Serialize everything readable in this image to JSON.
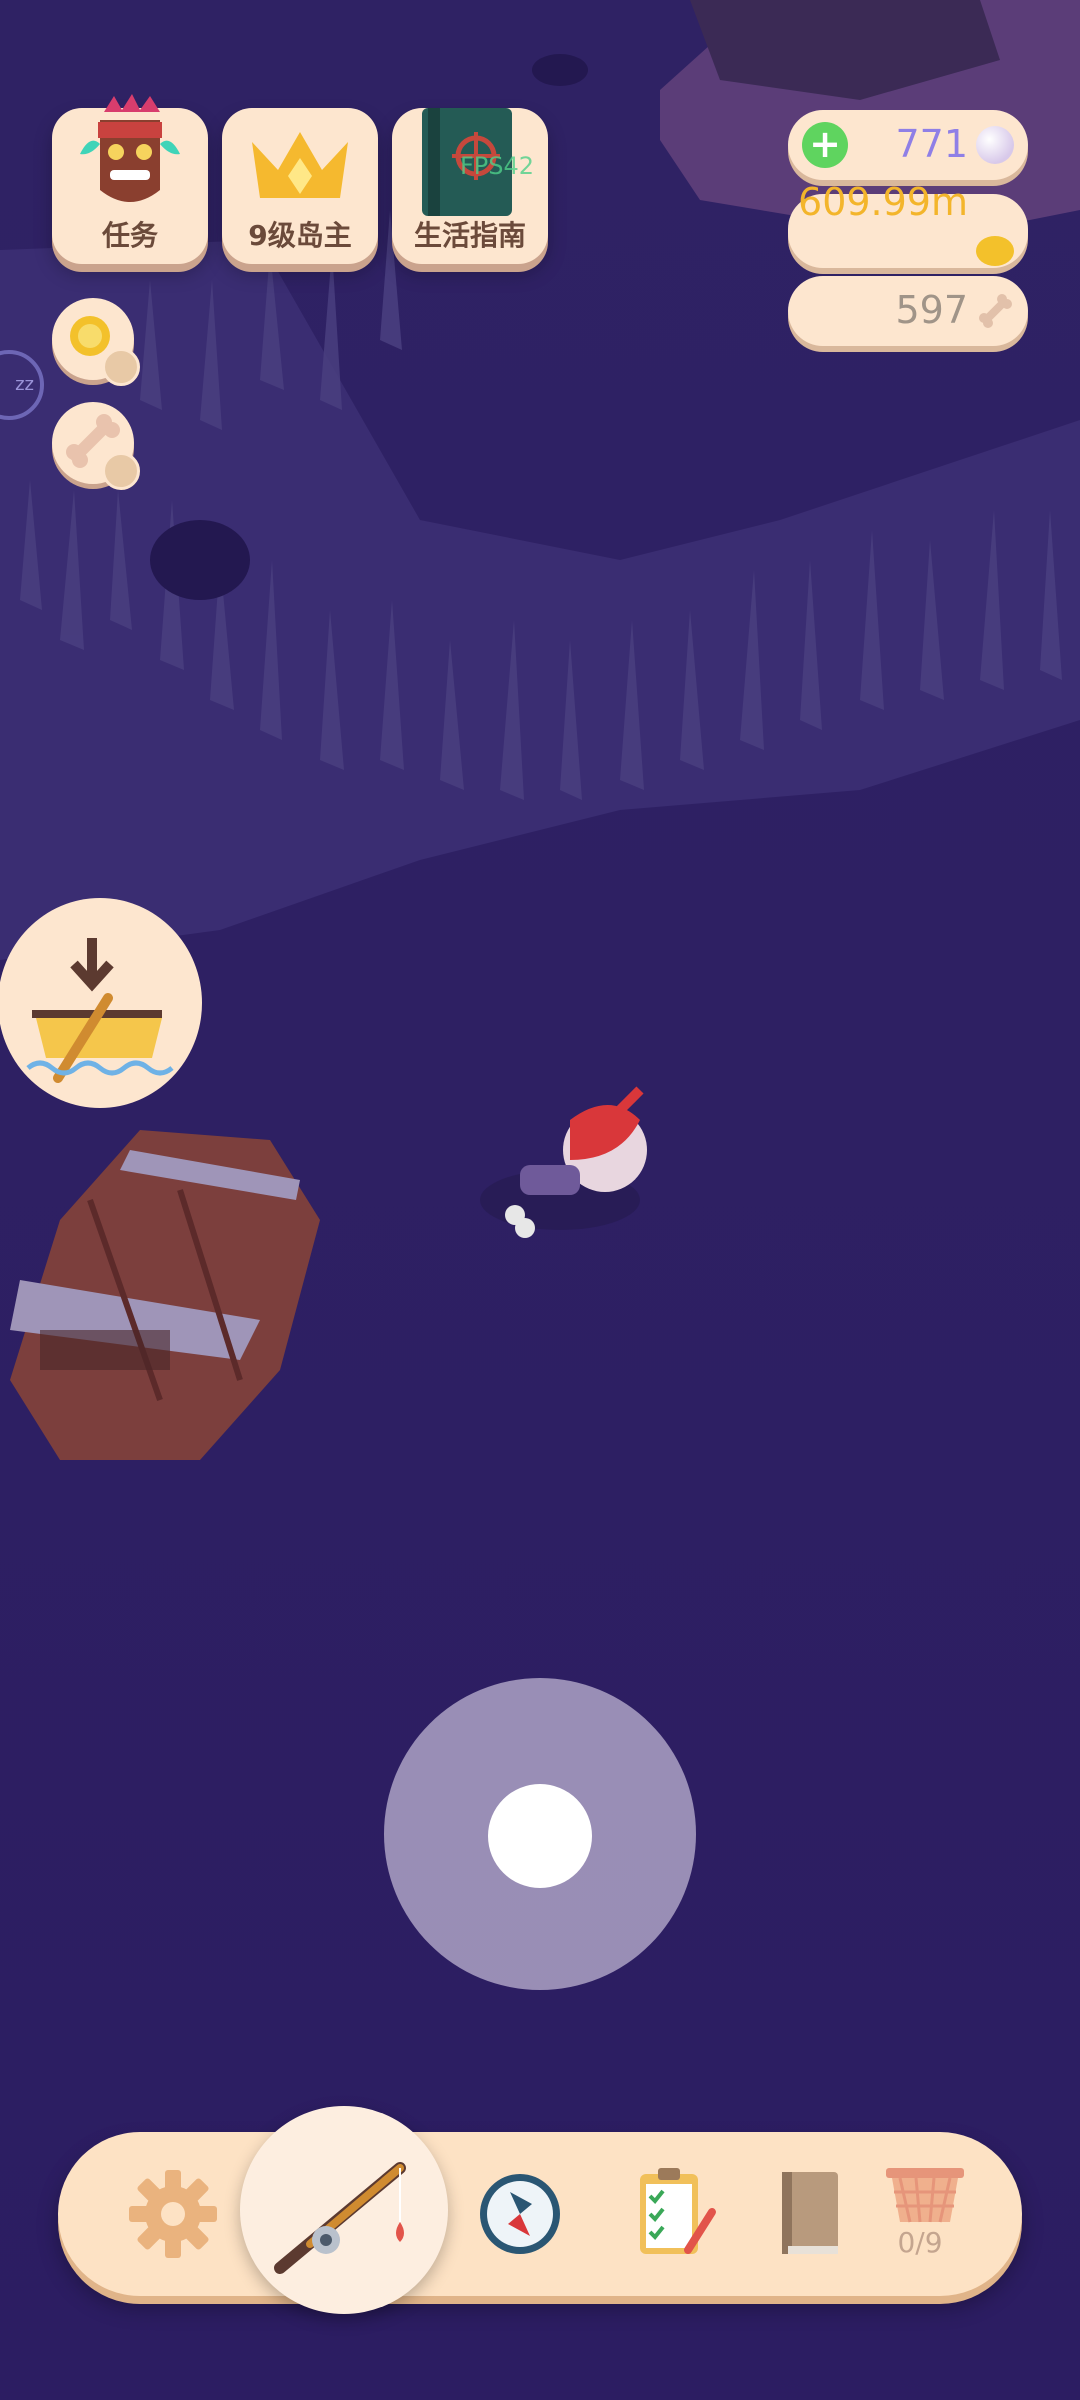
{
  "hud": {
    "top_buttons": [
      {
        "label": "任务",
        "icon": "tiki-mask-icon"
      },
      {
        "label": "9级岛主",
        "icon": "crown-icon"
      },
      {
        "label": "生活指南",
        "icon": "guide-book-icon"
      }
    ],
    "fps_text": "FPS42",
    "side_buttons": [
      {
        "icon": "gold-coin-video-icon"
      },
      {
        "icon": "bone-video-icon"
      }
    ],
    "sleep_icon": "zz"
  },
  "resources": {
    "pearls": {
      "value": "771",
      "icon": "pearl-icon",
      "add_icon": "plus-icon"
    },
    "coins": {
      "value": "609.99m",
      "icon": "gold-coin-icon"
    },
    "bones": {
      "value": "597",
      "icon": "bone-icon"
    }
  },
  "actions": {
    "boat_button_icon": "boat-dock-icon",
    "joystick": "virtual-joystick"
  },
  "bottom_bar": {
    "items": [
      {
        "icon": "gear-icon"
      },
      {
        "icon": "fishing-rod-icon"
      },
      {
        "icon": "compass-icon"
      },
      {
        "icon": "clipboard-checklist-icon"
      },
      {
        "icon": "book-icon"
      },
      {
        "icon": "basket-icon"
      }
    ],
    "basket_count": "0/9"
  },
  "colors": {
    "background": "#2e1f66",
    "panel": "#fde6cf",
    "pearl_text": "#8f7fe6",
    "coin_text": "#f3b52b",
    "bone_text": "#a09488",
    "accent_green": "#5fd45f"
  }
}
